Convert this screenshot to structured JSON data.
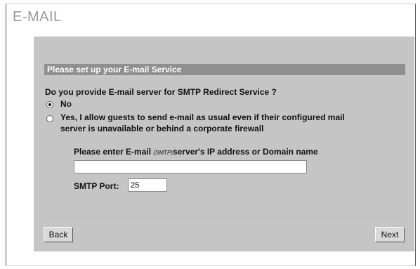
{
  "page": {
    "title": "E-MAIL"
  },
  "section": {
    "header": "Please set up your E-mail Service"
  },
  "question": "Do you provide E-mail server for SMTP Redirect Service ?",
  "options": [
    {
      "label": "No",
      "selected": true
    },
    {
      "label_line1": "Yes, I allow guests to send e-mail as usual even if their configured mail",
      "label_line2": "server is unavailable or behind a corporate firewall",
      "selected": false
    }
  ],
  "server": {
    "prompt_prefix": "Please enter E-mail ",
    "prompt_tag": "(SMTP)",
    "prompt_suffix": "server's IP address or Domain name",
    "value": ""
  },
  "port": {
    "label": "SMTP Port:",
    "value": "25"
  },
  "buttons": {
    "back": "Back",
    "next": "Next"
  }
}
